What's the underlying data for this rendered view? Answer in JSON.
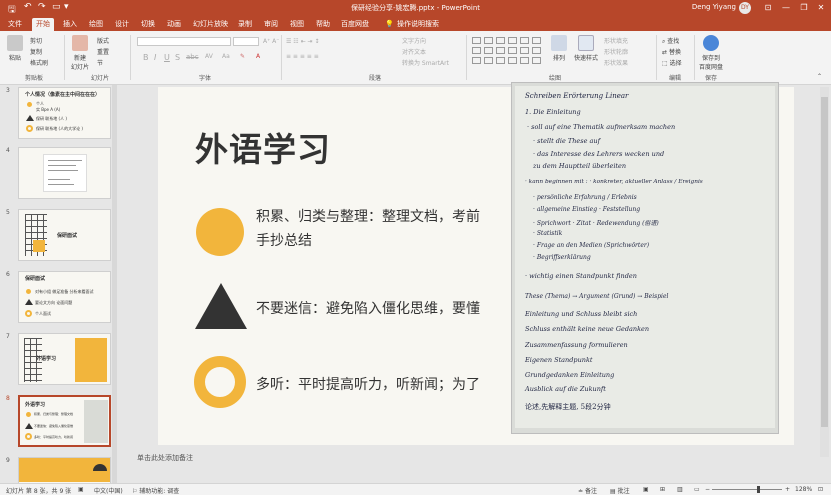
{
  "titlebar": {
    "document_title": "保研经验分享-姚宏腾.pptx  -  PowerPoint",
    "user_name": "Deng Yiyang",
    "user_initials": "DY",
    "minimize": "—",
    "restore": "❐",
    "close": "✕"
  },
  "tabs": [
    {
      "label": "文件"
    },
    {
      "label": "开始"
    },
    {
      "label": "插入"
    },
    {
      "label": "绘图"
    },
    {
      "label": "设计"
    },
    {
      "label": "切换"
    },
    {
      "label": "动画"
    },
    {
      "label": "幻灯片放映"
    },
    {
      "label": "录制"
    },
    {
      "label": "审阅"
    },
    {
      "label": "视图"
    },
    {
      "label": "帮助"
    },
    {
      "label": "百度网盘"
    },
    {
      "label": "操作说明搜索"
    }
  ],
  "ribbon": {
    "clipboard": {
      "paste": "粘贴",
      "cut": "剪切",
      "copy": "复制",
      "format_painter": "格式刷",
      "label": "剪贴板"
    },
    "slides": {
      "new_slide": "新建\n幻灯片",
      "layout": "版式",
      "reset": "重置",
      "section": "节",
      "label": "幻灯片"
    },
    "font": {
      "label": "字体"
    },
    "paragraph": {
      "text_direction": "文字方向",
      "align_text": "对齐文本",
      "smartart": "转换为 SmartArt",
      "label": "段落"
    },
    "drawing": {
      "arrange": "排列",
      "quick_styles": "快速样式",
      "shape_fill": "形状填充",
      "shape_outline": "形状轮廓",
      "shape_effects": "形状效果",
      "label": "绘图"
    },
    "editing": {
      "find": "查找",
      "replace": "替换",
      "select": "选择",
      "label": "编辑"
    },
    "save": {
      "save_to_baidu": "保存到\n百度网盘",
      "label": "保存"
    }
  },
  "thumbnails": [
    {
      "number": "3",
      "title": "个人情况（像素在主中间在在在）",
      "lines": [
        "个人    ",
        "实   Bpe   A (A)",
        "  保研 联系地 (人 )",
        "  保研 联系地 (人的大学论 )"
      ]
    },
    {
      "number": "4",
      "title": "",
      "lines": [
        "",
        "",
        ""
      ]
    },
    {
      "number": "5",
      "title": "保研面试",
      "lines": []
    },
    {
      "number": "6",
      "title": "保研面试",
      "lines": [
        "对有小组   做足准备   分析来看面试",
        "要论文方向   论面问题",
        "个人面试   "
      ]
    },
    {
      "number": "7",
      "title": "外语学习",
      "lines": []
    },
    {
      "number": "8",
      "title": "外语学习",
      "lines": [
        "积累、归类与整理：整理文档",
        "不要迷信：避免陷入僵化思维",
        "多听：平时提高听力，听新闻"
      ]
    },
    {
      "number": "9",
      "title": "",
      "lines": []
    }
  ],
  "slide": {
    "title": "外语学习",
    "bullets": [
      {
        "shape": "circle-icon",
        "text_line1": "积累、归类与整理：整理文档，考前",
        "text_line2": "手抄总结"
      },
      {
        "shape": "triangle-icon",
        "text_line1": "不要迷信：避免陷入僵化思维，要懂",
        "text_line2": ""
      },
      {
        "shape": "ring-icon",
        "text_line1": "多听：平时提高听力，听新闻；为了",
        "text_line2": ""
      }
    ],
    "handwriting": [
      "Schreiben  Erörterung  Linear",
      "1. Die Einleitung",
      "· soll auf eine Thematik aufmerksam machen",
      "  · stellt die These auf",
      "  · das Interesse des Lehrers wecken und",
      "    zu dem Hauptteil überleiten",
      "· kann beginnen mit : · konkreter, aktueller Anlass / Ereignis",
      "      · persönliche Erfahrung / Erlebnis",
      "      · allgemeine Einstieg · Feststellung",
      "      · Sprichwort · Zitat · Redewendung (俗语)",
      "      · Statistik",
      "      · Frage an den Medien (Sprichwörter)",
      "      · Begriffserklärung",
      "· wichtig  einen Standpunkt finden",
      "   These (Thema) → Argument (Grund) → Beispiel",
      "   Einleitung und Schluss bleibt sich",
      "   Schluss enthält keine neue Gedanken",
      "   Zusammenfassung formulieren",
      "   Eigenen Standpunkt",
      "   Grundgedanken  Einleitung",
      "   Ausblick auf die Zukunft",
      "论述,先解释主题, 5段2分钟"
    ]
  },
  "notes_placeholder": "单击此处添加备注",
  "statusbar": {
    "slide_info": "幻灯片 第 8 张，共 9 张",
    "language": "中文(中国)",
    "accessibility": "辅助功能: 调查",
    "notes": "备注",
    "comments": "批注",
    "zoom": "128%"
  }
}
